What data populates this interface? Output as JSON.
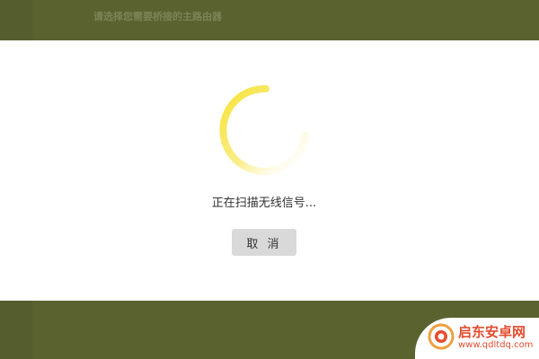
{
  "background": {
    "title": "请选择您需要桥接的主路由器"
  },
  "dialog": {
    "status_text": "正在扫描无线信号...",
    "cancel_label": "取 消"
  },
  "watermark": {
    "name": "启东安卓网",
    "url": "www.qdltdq.com"
  },
  "colors": {
    "backdrop": "#5a6230",
    "spinner": "#f7e23a",
    "button_bg": "#d9d9d9",
    "watermark": "#e44c2e"
  }
}
